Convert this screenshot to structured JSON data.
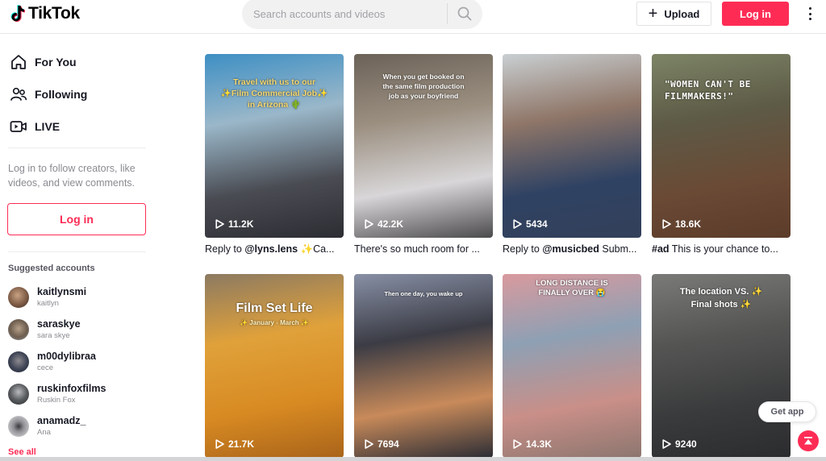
{
  "header": {
    "logo_text": "TikTok",
    "search_placeholder": "Search accounts and videos",
    "upload_label": "Upload",
    "login_label": "Log in"
  },
  "sidebar": {
    "nav": [
      {
        "label": "For You",
        "icon": "home-icon"
      },
      {
        "label": "Following",
        "icon": "users-icon"
      },
      {
        "label": "LIVE",
        "icon": "live-camera-icon"
      }
    ],
    "login_prompt": "Log in to follow creators, like videos, and view comments.",
    "login_label": "Log in",
    "suggested_title": "Suggested accounts",
    "accounts": [
      {
        "username": "kaitlynsmi",
        "name": "kaitlyn"
      },
      {
        "username": "saraskye",
        "name": "sara skye"
      },
      {
        "username": "m00dylibraa",
        "name": "cece"
      },
      {
        "username": "ruskinfoxfilms",
        "name": "Ruskin Fox"
      },
      {
        "username": "anamadz_",
        "name": "Ana"
      }
    ],
    "see_all": "See all"
  },
  "videos": [
    {
      "views": "11.2K",
      "overlay": "Travel with us to our ✨Film Commercial Job✨ in Arizona 🌵",
      "desc_prefix": "Reply to ",
      "desc_bold": "@lyns.lens",
      "desc_rest": " ✨Ca...",
      "colors": [
        "#3d8fc4",
        "#9ab7c9",
        "#4a4c53",
        "#2c2d33"
      ]
    },
    {
      "views": "42.2K",
      "overlay": "When you get booked on the same film production job as your boyfriend",
      "desc_prefix": "",
      "desc_bold": "",
      "desc_rest": "There's so much room for ...",
      "colors": [
        "#6b6258",
        "#9b8f80",
        "#d8d6d8",
        "#4b4a4c"
      ]
    },
    {
      "views": "5434",
      "overlay": "",
      "desc_prefix": "Reply to ",
      "desc_bold": "@musicbed",
      "desc_rest": " Subm...",
      "colors": [
        "#c9cfd2",
        "#8f7668",
        "#2f4263",
        "#33405a"
      ]
    },
    {
      "views": "18.6K",
      "overlay": "\"WOMEN CAN'T BE FILMMAKERS!\"",
      "desc_prefix": "",
      "desc_bold": "#ad",
      "desc_rest": " This is your chance to...",
      "colors": [
        "#7d8566",
        "#5d5a46",
        "#6a4a35",
        "#5c3c2a"
      ]
    },
    {
      "views": "21.7K",
      "overlay": "Film Set Life",
      "overlay2": "✨ January - March ✨",
      "desc_prefix": "",
      "desc_bold": "",
      "desc_rest": "",
      "colors": [
        "#8c7a62",
        "#e0a13a",
        "#d88a22",
        "#a9641a"
      ]
    },
    {
      "views": "7694",
      "overlay": "Then one day, you wake up",
      "desc_prefix": "",
      "desc_bold": "",
      "desc_rest": "",
      "colors": [
        "#8890a6",
        "#3b3c45",
        "#c88a5a",
        "#2c2d35"
      ]
    },
    {
      "views": "14.3K",
      "overlay": "LONG DISTANCE IS FINALLY OVER 😭",
      "desc_prefix": "",
      "desc_bold": "",
      "desc_rest": "",
      "colors": [
        "#d99a9e",
        "#8ea0b4",
        "#c98f88",
        "#8c766f"
      ]
    },
    {
      "views": "9240",
      "overlay": "The location VS. ✨ Final shots ✨",
      "desc_prefix": "",
      "desc_bold": "",
      "desc_rest": "",
      "colors": [
        "#7a7a78",
        "#555654",
        "#3a3b3c",
        "#2b2c2e"
      ]
    }
  ],
  "floating": {
    "get_app": "Get app"
  },
  "colors": {
    "brand": "#fe2c55",
    "text": "#161823",
    "muted": "#8a8b91"
  }
}
